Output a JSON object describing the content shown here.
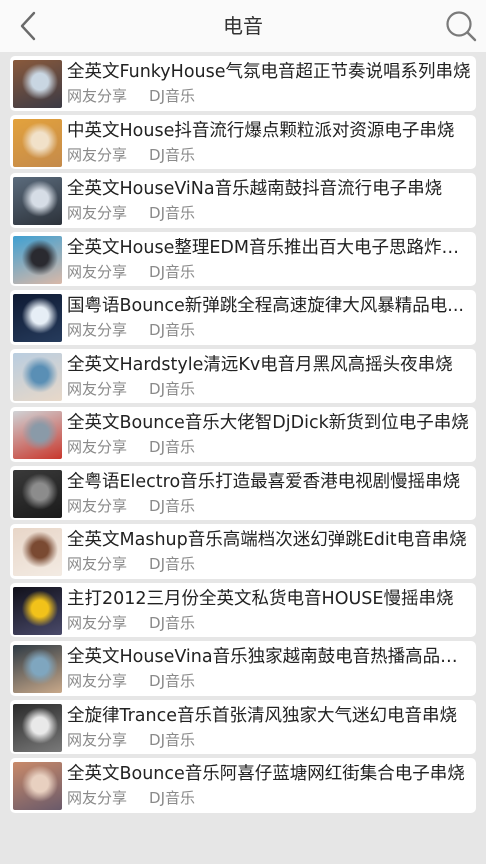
{
  "header": {
    "title": "电音",
    "back_icon": "chevron-left-icon",
    "search_icon": "search-icon"
  },
  "items": [
    {
      "title": "全英文FunkyHouse气氛电音超正节奏说唱系列串烧",
      "author": "网友分享",
      "source": "DJ音乐",
      "thumb_colors": [
        "#8a5a3c",
        "#c9d6e2",
        "#3b3a45"
      ]
    },
    {
      "title": "中英文House抖音流行爆点颗粒派对资源电子串烧",
      "author": "网友分享",
      "source": "DJ音乐",
      "thumb_colors": [
        "#e3a23c",
        "#f1e1c9",
        "#c48a4b"
      ]
    },
    {
      "title": "全英文HouseViNa音乐越南鼓抖音流行电子串烧",
      "author": "网友分享",
      "source": "DJ音乐",
      "thumb_colors": [
        "#5b6b7c",
        "#d6dde6",
        "#2c323a"
      ]
    },
    {
      "title": "全英文House整理EDM音乐推出百大电子思路炸场...",
      "author": "网友分享",
      "source": "DJ音乐",
      "thumb_colors": [
        "#3fa0d2",
        "#2a2a30",
        "#d9b8a8"
      ]
    },
    {
      "title": "国粤语Bounce新弹跳全程高速旋律大风暴精品电...",
      "author": "网友分享",
      "source": "DJ音乐",
      "thumb_colors": [
        "#0e1a33",
        "#e6eef6",
        "#263b5c"
      ]
    },
    {
      "title": "全英文Hardstyle清远Kv电音月黑风高摇头夜串烧",
      "author": "网友分享",
      "source": "DJ音乐",
      "thumb_colors": [
        "#b9cde0",
        "#5a8fb5",
        "#e8d8c8"
      ]
    },
    {
      "title": "全英文Bounce音乐大佬智DjDick新货到位电子串烧",
      "author": "网友分享",
      "source": "DJ音乐",
      "thumb_colors": [
        "#d0d3d6",
        "#8a9aa8",
        "#c8372c"
      ]
    },
    {
      "title": "全粤语Electro音乐打造最喜爱香港电视剧慢摇串烧",
      "author": "网友分享",
      "source": "DJ音乐",
      "thumb_colors": [
        "#3a3a3a",
        "#8c8c8c",
        "#1a1a1a"
      ]
    },
    {
      "title": "全英文Mashup音乐高端档次迷幻弹跳Edit电音串烧",
      "author": "网友分享",
      "source": "DJ音乐",
      "thumb_colors": [
        "#e8d6c8",
        "#7a4a32",
        "#f3ebe3"
      ]
    },
    {
      "title": "主打2012三月份全英文私货电音HOUSE慢摇串烧",
      "author": "网友分享",
      "source": "DJ音乐",
      "thumb_colors": [
        "#10101a",
        "#f2c21a",
        "#4a4a6a"
      ]
    },
    {
      "title": "全英文HouseVina音乐独家越南鼓电音热播高品串烧",
      "author": "网友分享",
      "source": "DJ音乐",
      "thumb_colors": [
        "#2e3a44",
        "#7fa6bf",
        "#c9a98a"
      ]
    },
    {
      "title": "全旋律Trance音乐首张清风独家大气迷幻电音串烧",
      "author": "网友分享",
      "source": "DJ音乐",
      "thumb_colors": [
        "#2a2a2a",
        "#e9e9e9",
        "#7a7a7a"
      ]
    },
    {
      "title": "全英文Bounce音乐阿喜仔蓝塘网红街集合电子串烧",
      "author": "网友分享",
      "source": "DJ音乐",
      "thumb_colors": [
        "#c98a6a",
        "#e8d0c0",
        "#6a5a6a"
      ]
    }
  ]
}
